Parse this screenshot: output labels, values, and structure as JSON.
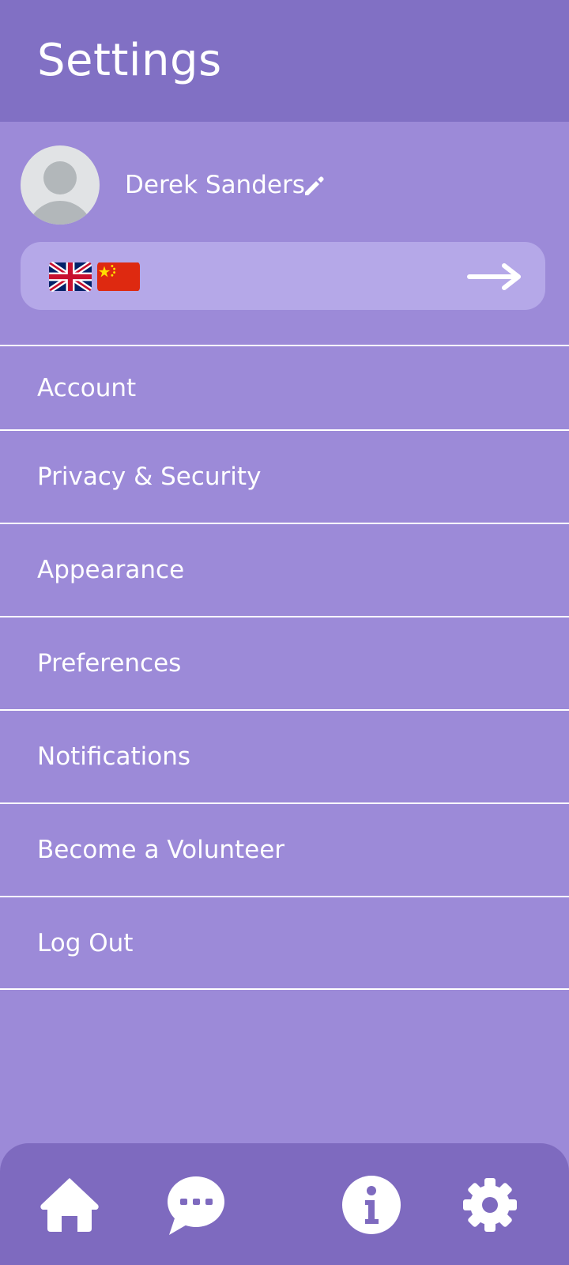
{
  "header": {
    "title": "Settings"
  },
  "profile": {
    "name": "Derek Sanders",
    "languages": [
      "English (UK)",
      "Chinese"
    ]
  },
  "menu": {
    "items": [
      {
        "label": "Account"
      },
      {
        "label": "Privacy & Security"
      },
      {
        "label": "Appearance"
      },
      {
        "label": "Preferences"
      },
      {
        "label": "Notifications"
      },
      {
        "label": "Become a Volunteer"
      },
      {
        "label": "Log Out"
      }
    ]
  },
  "nav": {
    "items": [
      "home-icon",
      "chat-icon",
      "info-icon",
      "settings-gear-icon"
    ]
  },
  "colors": {
    "header_bg": "#8170c4",
    "page_bg": "#9c8ad8",
    "lang_bar_bg": "#b5a8e8",
    "nav_bg": "#7e6abf",
    "text": "#ffffff"
  }
}
